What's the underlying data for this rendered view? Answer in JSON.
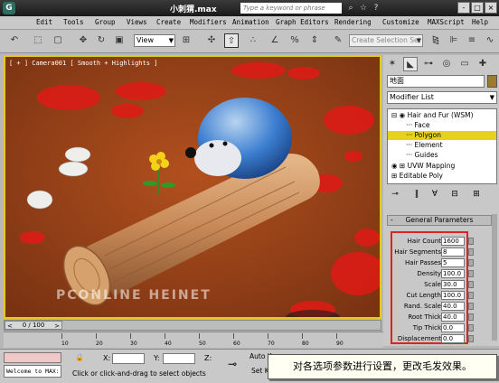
{
  "window": {
    "app_icon_label": "G",
    "title": "小刺猬.max",
    "search_placeholder": "Type a keyword or phrase",
    "buttons": [
      "-",
      "□",
      "×"
    ]
  },
  "menubar": {
    "items": [
      "Edit",
      "Tools",
      "Group",
      "Views",
      "Create",
      "Modifiers",
      "Animation",
      "Graph Editors",
      "Rendering",
      "Customize",
      "MAXScript",
      "Help"
    ]
  },
  "toolbar": {
    "view_select": "View",
    "selection_set_placeholder": "Create Selection Set",
    "percent_snap": "%"
  },
  "viewport": {
    "label": "[ + ] Camera001 [ Smooth + Highlights ]",
    "watermark": "PCONLINE  HEINET"
  },
  "command_panel": {
    "object_name": "地面",
    "modifier_list": "Modifier List",
    "stack": [
      {
        "label": "Hair and Fur (WSM)",
        "highlight": false
      },
      {
        "label": "Face",
        "highlight": false
      },
      {
        "label": "Polygon",
        "highlight": true
      },
      {
        "label": "Element",
        "highlight": false
      },
      {
        "label": "Guides",
        "highlight": false
      },
      {
        "label": "UVW Mapping",
        "highlight": false
      },
      {
        "label": "Editable Poly",
        "highlight": false
      }
    ],
    "rollout_title": "General Parameters",
    "rollout_toggle": "-",
    "params": [
      {
        "label": "Hair Count",
        "value": "1600"
      },
      {
        "label": "Hair Segments",
        "value": "8"
      },
      {
        "label": "Hair Passes",
        "value": "5"
      },
      {
        "label": "Density",
        "value": "100.0"
      },
      {
        "label": "Scale",
        "value": "30.0"
      },
      {
        "label": "Cut Length",
        "value": "100.0"
      },
      {
        "label": "Rand. Scale",
        "value": "40.0"
      },
      {
        "label": "Root Thick",
        "value": "40.0"
      },
      {
        "label": "Tip Thick",
        "value": "0.0"
      },
      {
        "label": "Displacement",
        "value": "0.0"
      }
    ]
  },
  "timeline": {
    "frame_display": "0 / 100",
    "ticks": [
      "10",
      "20",
      "30",
      "40",
      "50",
      "60",
      "70",
      "80",
      "90"
    ]
  },
  "statusbar": {
    "maxscript_text": "Welcome to MAX:",
    "x_label": "X:",
    "y_label": "Y:",
    "z_label": "Z:",
    "prompt": "Click or click-and-drag to select objects",
    "auto_key": "Auto K",
    "set_key": "Set Ke"
  },
  "caption": "对各选项参数进行设置，更改毛发效果。",
  "colors": {
    "viewport_border": "#e6c823",
    "highlight": "#e6d21c",
    "param_box_border": "#e0241c"
  }
}
